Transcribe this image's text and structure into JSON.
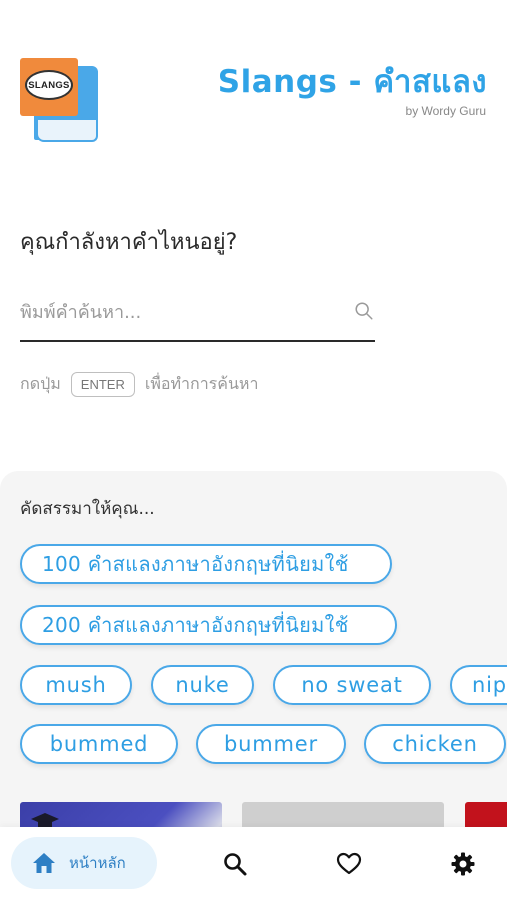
{
  "header": {
    "logo_text": "SLANGS",
    "title": "Slangs - คำสแลง",
    "subtitle": "by Wordy Guru"
  },
  "search": {
    "question": "คุณกำลังหาคำไหนอยู่?",
    "placeholder": "พิมพ์คำค้นหา...",
    "value": "",
    "hint_before": "กดปุ่ม",
    "hint_key": "ENTER",
    "hint_after": "เพื่อทำการค้นหา"
  },
  "suggestions": {
    "title": "คัดสรรมาให้คุณ...",
    "chips": [
      "100 คำสแลงภาษาอังกฤษที่นิยมใช้",
      "200 คำสแลงภาษาอังกฤษที่นิยมใช้",
      "mush",
      "nuke",
      "no sweat",
      "nip",
      "bummed",
      "bummer",
      "chicken"
    ]
  },
  "nav": {
    "home_label": "หน้าหลัก",
    "icons": [
      "home-icon",
      "search-icon",
      "heart-icon",
      "gear-icon"
    ]
  },
  "colors": {
    "accent": "#2fa3e6",
    "chip_border": "#4aa8e8",
    "nav_active_bg": "#e6f3fc"
  }
}
